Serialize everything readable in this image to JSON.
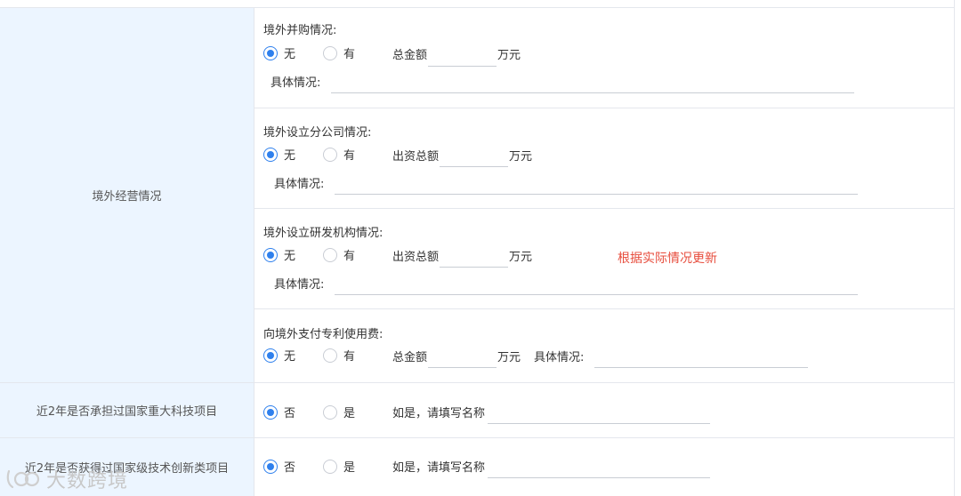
{
  "overseas": {
    "section_label": "境外经营情况",
    "acquisition": {
      "title": "境外并购情况:",
      "opt_no": "无",
      "opt_yes": "有",
      "amount_label": "总金额",
      "unit": "万元",
      "detail_label": "具体情况:",
      "selected": "无"
    },
    "branch": {
      "title": "境外设立分公司情况:",
      "opt_no": "无",
      "opt_yes": "有",
      "amount_label": "出资总额",
      "unit": "万元",
      "detail_label": "具体情况:",
      "selected": "无"
    },
    "rd": {
      "title": "境外设立研发机构情况:",
      "opt_no": "无",
      "opt_yes": "有",
      "amount_label": "出资总额",
      "unit": "万元",
      "detail_label": "具体情况:",
      "selected": "无",
      "note": "根据实际情况更新"
    },
    "patent": {
      "title": "向境外支付专利使用费:",
      "opt_no": "无",
      "opt_yes": "有",
      "amount_label": "总金额",
      "unit": "万元",
      "detail_label": "具体情况:",
      "selected": "无"
    }
  },
  "major_project": {
    "label": "近2年是否承担过国家重大科技项目",
    "opt_no": "否",
    "opt_yes": "是",
    "name_label": "如是，请填写名称",
    "selected": "否"
  },
  "innovation_project": {
    "label": "近2年是否获得过国家级技术创新类项目",
    "opt_no": "否",
    "opt_yes": "是",
    "name_label": "如是，请填写名称",
    "selected": "否"
  },
  "watermark": {
    "text": "大数跨境"
  },
  "colors": {
    "label_bg": "#ecf5ff",
    "radio_accent": "#2f80ed",
    "note_red": "#e74c3c",
    "border": "#e4e7ed"
  }
}
